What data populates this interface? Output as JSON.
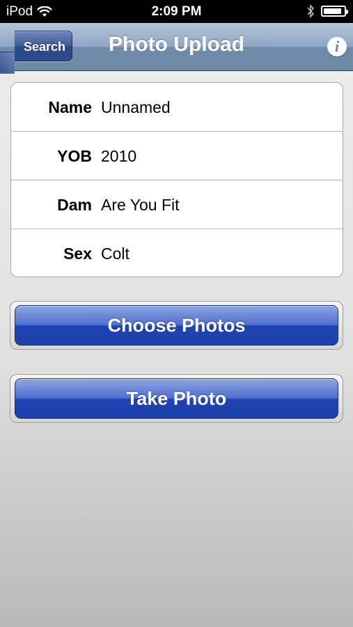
{
  "status_bar": {
    "carrier": "iPod",
    "time": "2:09 PM",
    "battery_level": 0.9
  },
  "nav": {
    "back_label": "Search",
    "title": "Photo Upload",
    "info_glyph": "i"
  },
  "details": [
    {
      "label": "Name",
      "value": "Unnamed"
    },
    {
      "label": "YOB",
      "value": "2010"
    },
    {
      "label": "Dam",
      "value": "Are You Fit"
    },
    {
      "label": "Sex",
      "value": "Colt"
    }
  ],
  "buttons": {
    "choose_photos": "Choose Photos",
    "take_photo": "Take Photo"
  }
}
